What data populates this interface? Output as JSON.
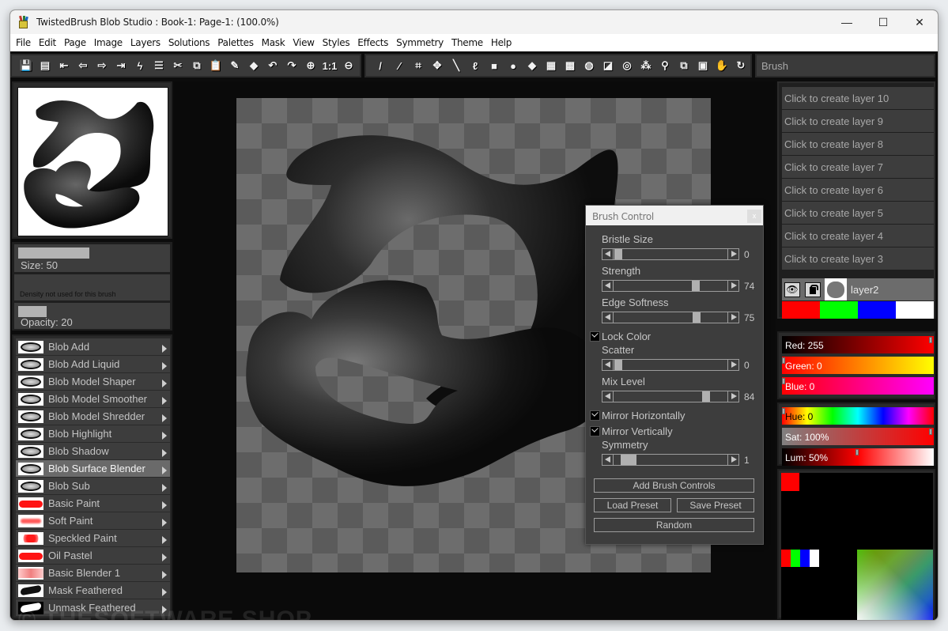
{
  "window": {
    "title": "TwistedBrush Blob Studio : Book-1: Page-1:  (100.0%)",
    "controls": {
      "minimize": "—",
      "maximize": "☐",
      "close": "✕"
    }
  },
  "menu": [
    "File",
    "Edit",
    "Page",
    "Image",
    "Layers",
    "Solutions",
    "Palettes",
    "Mask",
    "View",
    "Styles",
    "Effects",
    "Symmetry",
    "Theme",
    "Help"
  ],
  "toolbar_left": [
    {
      "name": "save-icon",
      "glyph": "💾"
    },
    {
      "name": "book-icon",
      "glyph": "▤"
    },
    {
      "name": "first-page-icon",
      "glyph": "⇤"
    },
    {
      "name": "prev-page-icon",
      "glyph": "⇦"
    },
    {
      "name": "next-page-icon",
      "glyph": "⇨"
    },
    {
      "name": "last-page-icon",
      "glyph": "⇥"
    },
    {
      "name": "lightning-icon",
      "glyph": "ϟ"
    },
    {
      "name": "page-list-icon",
      "glyph": "☰"
    },
    {
      "name": "cut-icon",
      "glyph": "✂"
    },
    {
      "name": "copy-icon",
      "glyph": "⧉"
    },
    {
      "name": "paste-icon",
      "glyph": "📋"
    },
    {
      "name": "erase-page-icon",
      "glyph": "✎"
    },
    {
      "name": "fill-page-icon",
      "glyph": "◆"
    },
    {
      "name": "undo-icon",
      "glyph": "↶"
    },
    {
      "name": "redo-icon",
      "glyph": "↷"
    },
    {
      "name": "zoom-in-icon",
      "glyph": "⊕"
    },
    {
      "name": "zoom-actual-icon",
      "glyph": "1:1"
    },
    {
      "name": "zoom-out-icon",
      "glyph": "⊖"
    }
  ],
  "toolbar_right": [
    {
      "name": "brush-tool-icon",
      "glyph": "/"
    },
    {
      "name": "eyedropper-icon",
      "glyph": "⁄"
    },
    {
      "name": "crop-icon",
      "glyph": "⌗"
    },
    {
      "name": "move-icon",
      "glyph": "✥"
    },
    {
      "name": "line-icon",
      "glyph": "╲"
    },
    {
      "name": "lasso-icon",
      "glyph": "ℓ"
    },
    {
      "name": "rectangle-icon",
      "glyph": "■"
    },
    {
      "name": "ellipse-icon",
      "glyph": "●"
    },
    {
      "name": "fill-bucket-icon",
      "glyph": "◆"
    },
    {
      "name": "gradient-icon",
      "glyph": "▦"
    },
    {
      "name": "select-rect-icon",
      "glyph": "▩"
    },
    {
      "name": "select-ellipse-icon",
      "glyph": "◍"
    },
    {
      "name": "select-poly-icon",
      "glyph": "◪"
    },
    {
      "name": "select-magic-icon",
      "glyph": "◎"
    },
    {
      "name": "magic-wand-icon",
      "glyph": "⁂"
    },
    {
      "name": "pick-icon",
      "glyph": "⚲"
    },
    {
      "name": "copy-selection-icon",
      "glyph": "⧉"
    },
    {
      "name": "paste-selection-icon",
      "glyph": "▣"
    },
    {
      "name": "hand-icon",
      "glyph": "✋"
    },
    {
      "name": "rotate-icon",
      "glyph": "↻"
    }
  ],
  "brush_label": "Brush",
  "brush_params": {
    "size_label": "Size: 50",
    "size_value": 50,
    "density_label": "Density not used for this brush",
    "opacity_label": "Opacity: 20",
    "opacity_value": 20
  },
  "brushes": [
    {
      "label": "Blob Add",
      "thumb": "blob"
    },
    {
      "label": "Blob Add Liquid",
      "thumb": "blob"
    },
    {
      "label": "Blob Model Shaper",
      "thumb": "blob"
    },
    {
      "label": "Blob Model Smoother",
      "thumb": "blob"
    },
    {
      "label": "Blob Model Shredder",
      "thumb": "blob"
    },
    {
      "label": "Blob Highlight",
      "thumb": "blob"
    },
    {
      "label": "Blob Shadow",
      "thumb": "blob"
    },
    {
      "label": "Blob Surface Blender",
      "thumb": "blob",
      "selected": true
    },
    {
      "label": "Blob Sub",
      "thumb": "blob"
    },
    {
      "label": "Basic Paint",
      "thumb": "red"
    },
    {
      "label": "Soft Paint",
      "thumb": "soft"
    },
    {
      "label": "Speckled Paint",
      "thumb": "speck"
    },
    {
      "label": "Oil Pastel",
      "thumb": "red"
    },
    {
      "label": "Basic Blender 1",
      "thumb": "blend"
    },
    {
      "label": "Mask Feathered",
      "thumb": "mask"
    },
    {
      "label": "Unmask Feathered",
      "thumb": "unmask"
    }
  ],
  "brush_control": {
    "title": "Brush Control",
    "close": "x",
    "sliders": [
      {
        "label": "Bristle Size",
        "value": 0,
        "max": 100
      },
      {
        "label": "Strength",
        "value": 74,
        "max": 100
      },
      {
        "label": "Edge Softness",
        "value": 75,
        "max": 100
      },
      {
        "label": "Scatter",
        "value": 0,
        "max": 100
      },
      {
        "label": "Mix Level",
        "value": 84,
        "max": 100
      },
      {
        "label": "Symmetry",
        "value": 1,
        "max": 16
      }
    ],
    "checkboxes": [
      {
        "label": "Lock Color",
        "checked": true
      },
      {
        "label": "Mirror Horizontally",
        "checked": true
      },
      {
        "label": "Mirror Vertically",
        "checked": true
      }
    ],
    "buttons": {
      "add_controls": "Add Brush Controls",
      "load_preset": "Load Preset",
      "save_preset": "Save Preset",
      "random": "Random"
    }
  },
  "layers": {
    "create": [
      "Click to create layer 10",
      "Click to create layer 9",
      "Click to create layer 8",
      "Click to create layer 7",
      "Click to create layer 6",
      "Click to create layer 5",
      "Click to create layer 4",
      "Click to create layer 3"
    ],
    "active": {
      "name": "layer2",
      "visible": true,
      "locked": false
    }
  },
  "quick_swatches": [
    "#ff0000",
    "#00ff00",
    "#0000ff",
    "#ffffff"
  ],
  "color": {
    "red_label": "Red: 255",
    "red": 255,
    "green_label": "Green: 0",
    "green": 0,
    "blue_label": "Blue: 0",
    "blue": 0,
    "hue_label": "Hue: 0",
    "hue": 0,
    "sat_label": "Sat: 100%",
    "sat": 100,
    "lum_label": "Lum: 50%",
    "lum": 50,
    "current": "#ff0000",
    "palette": [
      "#ff0000",
      "#00ff00",
      "#0000ff",
      "#ffffff"
    ]
  },
  "watermark": "© THESOFTWARE.SHOP"
}
